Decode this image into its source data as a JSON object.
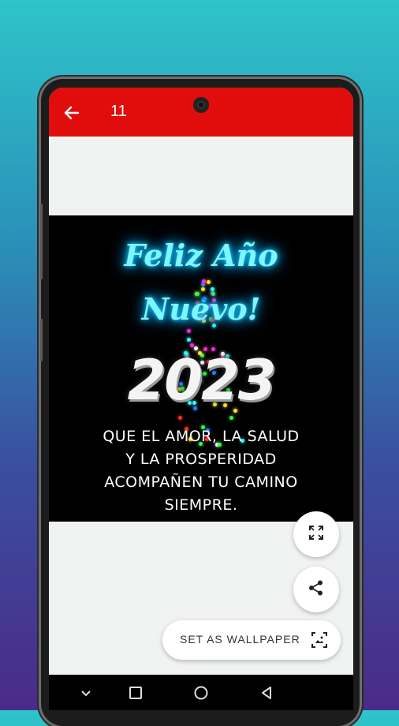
{
  "appbar": {
    "title": "11",
    "color": "#e10d0d"
  },
  "wallpaper": {
    "line1": "Feliz Año",
    "line2": "Nuevo!",
    "year": "2023",
    "message_lines": [
      "QUE EL AMOR, LA SALUD",
      "Y LA PROSPERIDAD",
      "ACOMPAÑEN TU CAMINO",
      "SIEMPRE."
    ]
  },
  "actions": {
    "fullscreen_icon": "fullscreen-icon",
    "share_icon": "share-icon",
    "set_wallpaper_label": "SET AS WALLPAPER",
    "set_wallpaper_icon": "wallpaper-icon"
  },
  "navbar": {
    "buttons": [
      "chevron-down-icon",
      "recents-icon",
      "home-icon",
      "back-triangle-icon"
    ]
  },
  "colors": {
    "accent": "#e10d0d",
    "neon": "#7ff6ff"
  }
}
